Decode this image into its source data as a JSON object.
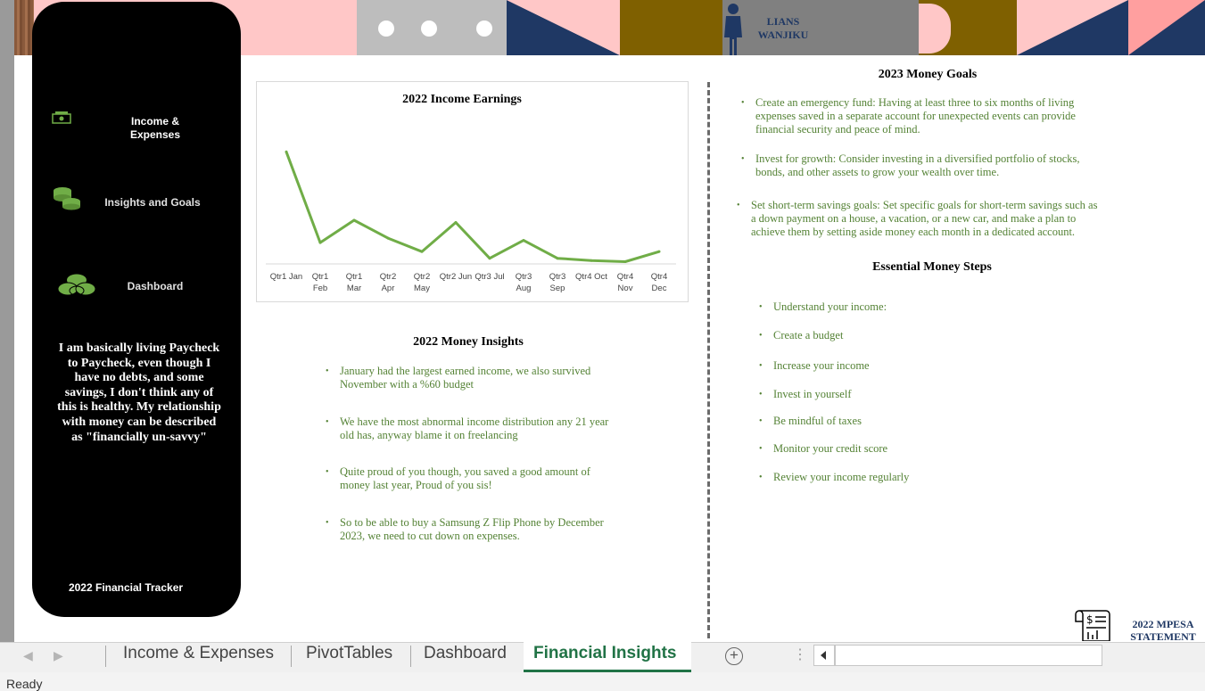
{
  "banner": {
    "name_line1": "LIANS",
    "name_line2": "WANJIKU"
  },
  "sidebar": {
    "items": [
      {
        "label_line1": "Income &",
        "label_line2": "Expenses",
        "icon": "money-icon"
      },
      {
        "label": "Insights and Goals",
        "icon": "coins-icon"
      },
      {
        "label": "Dashboard",
        "icon": "coin-stack-icon"
      }
    ],
    "quote": "I am basically living Paycheck to Paycheck, even though I have no debts, and some savings, I don't think any of this is healthy. My relationship with money can be described as \"financially un-savvy\"",
    "footer": "2022 Financial Tracker"
  },
  "chart_data": {
    "type": "line",
    "title": "2022 Income Earnings",
    "categories": [
      "Qtr1 Jan",
      "Qtr1 Feb",
      "Qtr1 Mar",
      "Qtr2 Apr",
      "Qtr2 May",
      "Qtr2 Jun",
      "Qtr3 Jul",
      "Qtr3 Aug",
      "Qtr3 Sep",
      "Qtr4 Oct",
      "Qtr4 Nov",
      "Qtr4 Dec"
    ],
    "tick_labels": [
      [
        "Qtr1 Jan",
        ""
      ],
      [
        "Qtr1",
        "Feb"
      ],
      [
        "Qtr1",
        "Mar"
      ],
      [
        "Qtr2",
        "Apr"
      ],
      [
        "Qtr2",
        "May"
      ],
      [
        "Qtr2 Jun",
        ""
      ],
      [
        "Qtr3 Jul",
        ""
      ],
      [
        "Qtr3",
        "Aug"
      ],
      [
        "Qtr3",
        "Sep"
      ],
      [
        "Qtr4 Oct",
        ""
      ],
      [
        "Qtr4",
        "Nov"
      ],
      [
        "Qtr4",
        "Dec"
      ]
    ],
    "series": [
      {
        "values": [
          100,
          19,
          39,
          23,
          11,
          37,
          5,
          21,
          5,
          3,
          2,
          11
        ]
      }
    ],
    "ylim": [
      0,
      105
    ],
    "color": "#70ad47",
    "grid": false,
    "legend": "none"
  },
  "insights": {
    "title": "2022 Money Insights",
    "items": [
      "January had the largest earned income, we also survived November with a %60 budget",
      "We have the most abnormal income distribution any 21 year old has, anyway blame it on freelancing",
      "Quite proud of you though, you saved a good amount of money last year, Proud of you sis!",
      "So to be able to buy a Samsung Z Flip Phone by December 2023, we need to cut down on expenses."
    ]
  },
  "goals": {
    "title": "2023 Money Goals",
    "items": [
      "Create an emergency fund: Having at least three to six months of living expenses saved in a separate account for unexpected events can provide financial security and peace of mind.",
      "Invest for growth: Consider investing in a diversified portfolio of stocks, bonds, and other assets to grow your wealth over time.",
      "Set short-term savings goals: Set specific goals for short-term savings such as a down payment on a house, a vacation, or a new car, and make a plan to achieve them by setting aside money each month in a dedicated account."
    ]
  },
  "steps": {
    "title": "Essential Money Steps",
    "items": [
      "Understand your income:",
      "Create a budget",
      "Increase your income",
      "Invest in yourself",
      "Be mindful of taxes",
      "Monitor your credit score",
      "Review your income regularly"
    ]
  },
  "mpesa": {
    "line1": "2022 MPESA",
    "line2": "STATEMENT"
  },
  "tabs": [
    {
      "label": "Income & Expenses",
      "active": false
    },
    {
      "label": "PivotTables",
      "active": false
    },
    {
      "label": "Dashboard",
      "active": false
    },
    {
      "label": "Financial Insights",
      "active": true
    }
  ],
  "status": {
    "text": "Ready"
  },
  "colors": {
    "accent_green": "#548235",
    "line_green": "#70ad47",
    "active_tab": "#217346",
    "navy": "#1f3864",
    "pink": "#ffc7c7",
    "olive": "#7f6000"
  }
}
